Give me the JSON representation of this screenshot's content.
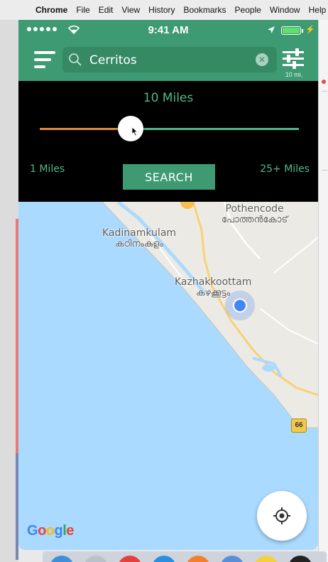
{
  "menubar": {
    "app": "Chrome",
    "items": [
      "File",
      "Edit",
      "View",
      "History",
      "Bookmarks",
      "People",
      "Window",
      "Help"
    ]
  },
  "status": {
    "time": "9:41 AM"
  },
  "header": {
    "search_value": "Cerritos",
    "filter_label": "10 mi."
  },
  "distance_panel": {
    "value_label": "10 Miles",
    "min_label": "1 Miles",
    "max_label": "25+ Miles",
    "slider_fraction": 0.35,
    "search_button": "SEARCH"
  },
  "map": {
    "labels": [
      {
        "en": "Pothencode",
        "ml": "പോത്തൻകോട്"
      },
      {
        "en": "Kadinamkulam",
        "ml": "കഠിനംകുളം"
      },
      {
        "en": "Kazhakkoottam",
        "ml": "കഴക്കൂട്ടം"
      }
    ],
    "route_shield": "66",
    "attribution": [
      "G",
      "o",
      "o",
      "g",
      "l",
      "e"
    ]
  },
  "colors": {
    "brand": "#3e9a72",
    "accent": "#4fb88a",
    "slider_fill": "#e28a3c",
    "panel": "#000000",
    "water": "#aadaff"
  }
}
